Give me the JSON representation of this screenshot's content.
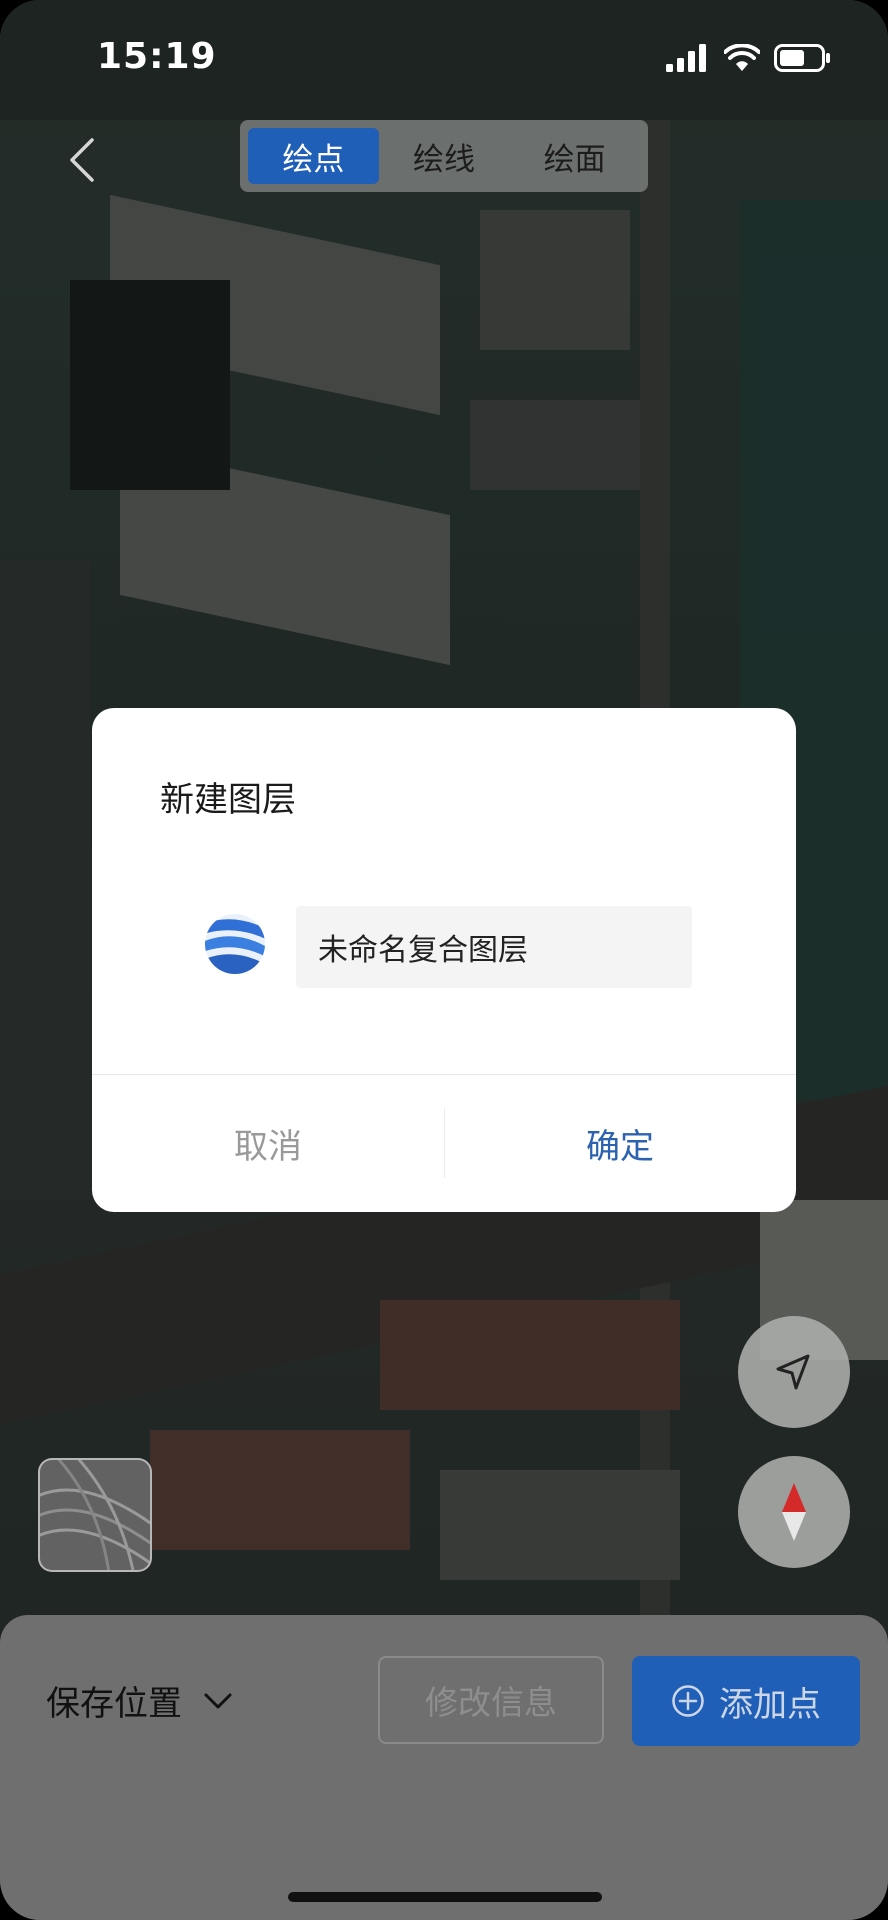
{
  "status": {
    "time": "15:19"
  },
  "toolbar": {
    "tabs": [
      {
        "label": "绘点",
        "active": true
      },
      {
        "label": "绘线",
        "active": false
      },
      {
        "label": "绘面",
        "active": false
      }
    ]
  },
  "dialog": {
    "title": "新建图层",
    "layer_name_value": "未命名复合图层",
    "cancel_label": "取消",
    "confirm_label": "确定"
  },
  "bottom": {
    "save_position_label": "保存位置",
    "edit_info_label": "修改信息",
    "add_point_label": "添加点"
  },
  "colors": {
    "accent": "#1f5fb8",
    "confirm_text": "#2c62b0",
    "cancel_text": "#9a9a9a",
    "compass_red": "#d42a2a"
  }
}
